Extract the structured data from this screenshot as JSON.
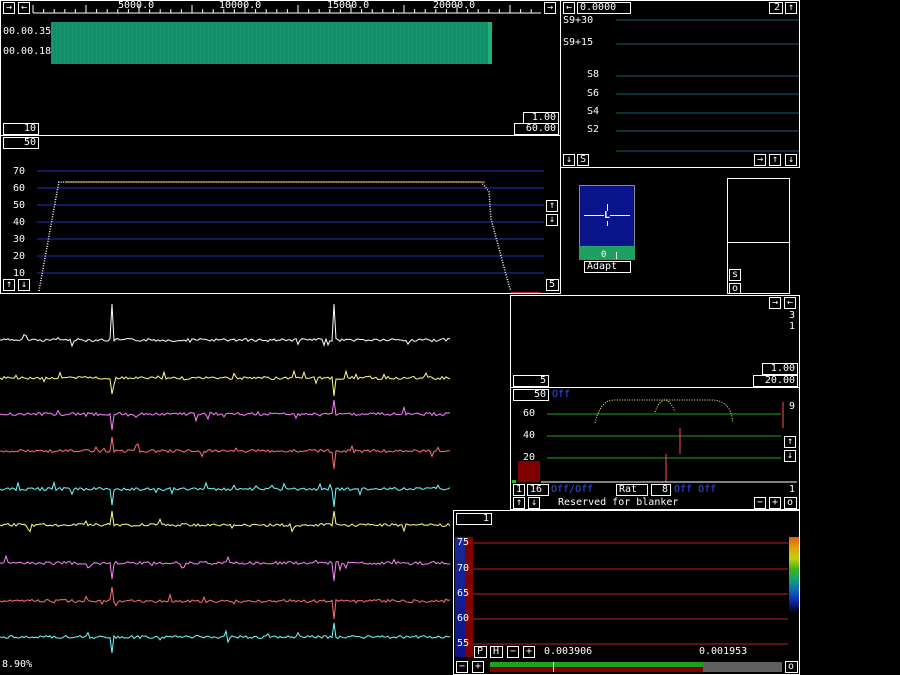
{
  "waterfall": {
    "freq_ticks": [
      "5000.0",
      "10000.0",
      "15000.0",
      "20000.0"
    ],
    "time_labels": [
      "00.00.35",
      "00.00.18"
    ],
    "gain": "1.00",
    "span": "60.00",
    "avg": "10"
  },
  "spectrum": {
    "avg": "50",
    "y_ticks": [
      "70",
      "60",
      "50",
      "40",
      "30",
      "20",
      "10"
    ],
    "right_value": "5"
  },
  "smeter": {
    "value": "0.0000",
    "count": "2",
    "labels": [
      "S9+30",
      "S9+15",
      "S8",
      "S6",
      "S4",
      "S2"
    ],
    "s_btn": "S"
  },
  "afc": {
    "mode_letter": "L",
    "value": "0",
    "adapt_label": "Adapt"
  },
  "side_panel": {
    "s_btn": "s",
    "o_btn": "o"
  },
  "coherent": {
    "top_values": [
      "3",
      "1"
    ],
    "gain": "1.00",
    "span": "20.00",
    "avg": "5"
  },
  "blanker": {
    "avg": "50",
    "off_label": "Off",
    "y_ticks": [
      "60",
      "40",
      "20"
    ],
    "right_value": "9",
    "ch1": "1",
    "ch2": "16",
    "mode_left": "Off/Off",
    "rat_label": "Rat",
    "rat_value": "8",
    "mode_right": "Off Off",
    "bottom_right": "1",
    "reserved_label": "Reserved for blanker"
  },
  "baseband": {
    "avg": "1",
    "y_ticks": [
      "75",
      "70",
      "65",
      "60",
      "55"
    ],
    "p_btn": "P",
    "h_btn": "H",
    "val1": "0.003906",
    "val2": "0.001953",
    "bar_fill": 0.73
  },
  "timf": {
    "cpu_load": "8.90%",
    "trace_colors": [
      "#ffffff",
      "#ffff80",
      "#ff80ff",
      "#ff7070",
      "#70ffff",
      "#ffff80",
      "#ff80ff",
      "#ff7070",
      "#70ffff"
    ]
  },
  "colors": {
    "waterfall_green": "#12906a",
    "grid_blue": "#2030c0",
    "grid_red": "#c02020",
    "grid_green": "#20a020",
    "yellow": "#ffff80",
    "red_bar": "#800000"
  }
}
